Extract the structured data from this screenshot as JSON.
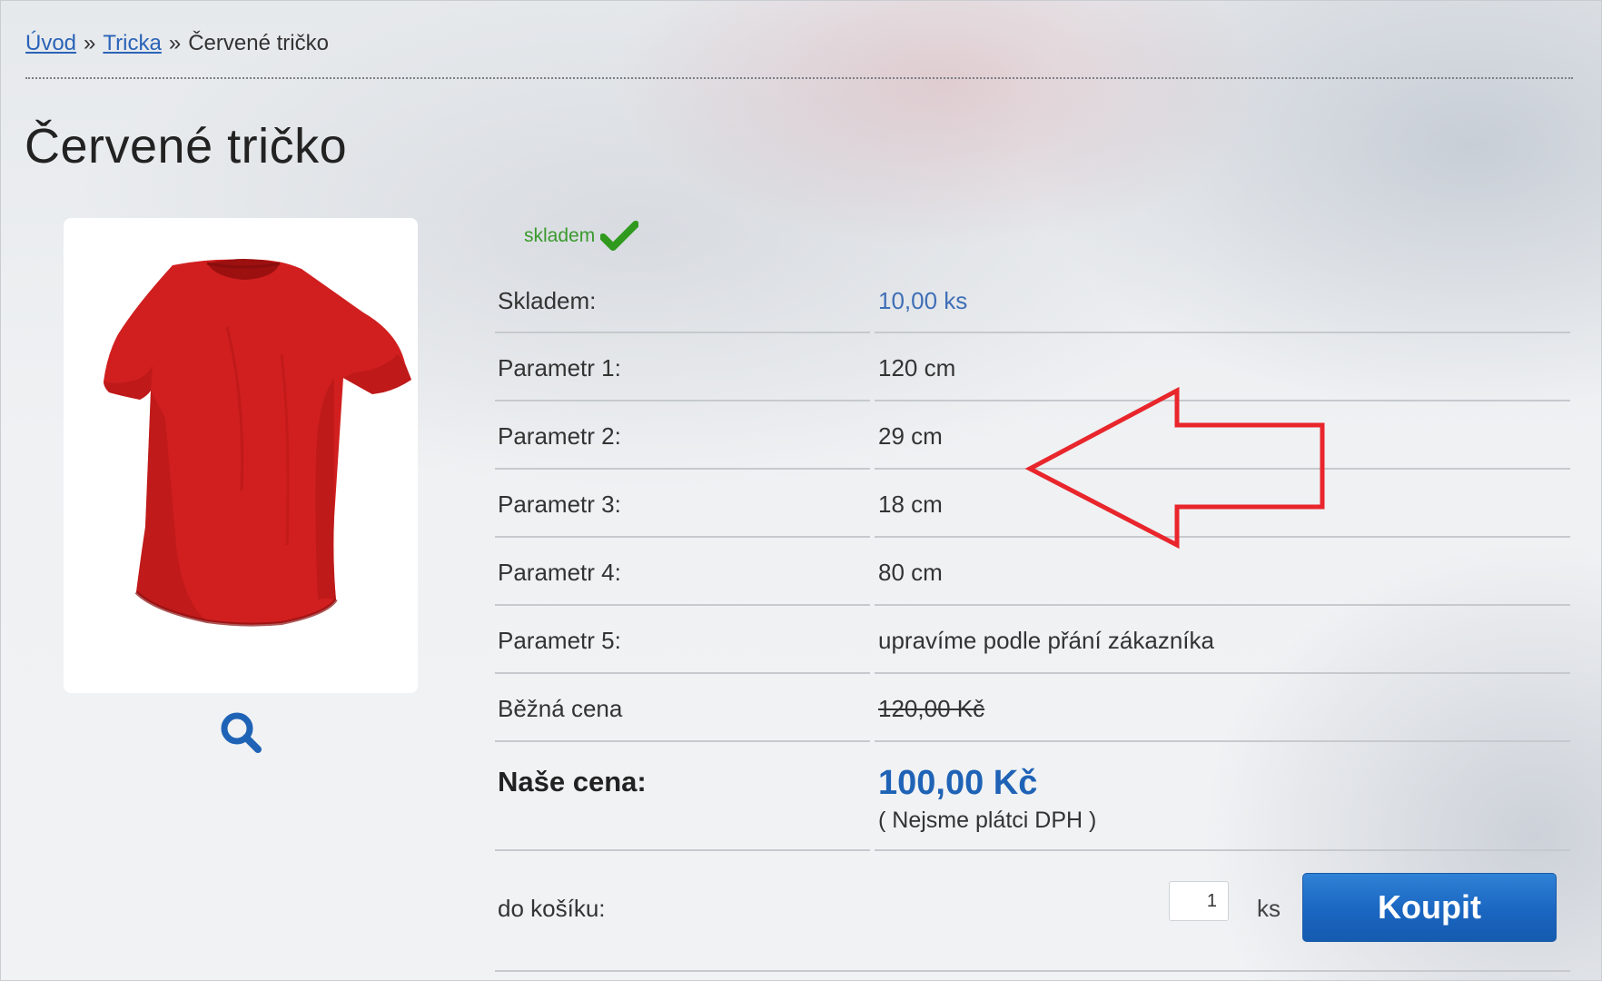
{
  "breadcrumb": {
    "home": "Úvod",
    "category": "Tricka",
    "current": "Červené tričko",
    "separator": "»"
  },
  "product": {
    "title": "Červené tričko",
    "image_icon": "red-tshirt-image",
    "zoom_icon": "magnifier-icon",
    "stock_badge": {
      "text": "skladem",
      "icon": "checkmark-icon",
      "color": "#3a9a2c"
    }
  },
  "params": [
    {
      "label": "Skladem:",
      "value": "10,00 ks"
    },
    {
      "label": "Parametr 1:",
      "value": "120 cm"
    },
    {
      "label": "Parametr 2:",
      "value": "29 cm"
    },
    {
      "label": "Parametr 3:",
      "value": "18 cm"
    },
    {
      "label": "Parametr 4:",
      "value": "80 cm"
    },
    {
      "label": "Parametr 5:",
      "value": "upravíme podle přání zákazníka"
    }
  ],
  "regular_price": {
    "label": "Běžná cena",
    "value": "120,00 Kč"
  },
  "our_price": {
    "label": "Naše cena:",
    "value": "100,00 Kč",
    "note": "( Nejsme plátci DPH )"
  },
  "cart": {
    "label": "do košíku:",
    "quantity": "1",
    "unit": "ks",
    "button": "Koupit"
  },
  "colors": {
    "accent": "#1f63b6",
    "link": "#2a63b8",
    "annotation_arrow": "#e8262c"
  },
  "annotation": {
    "icon": "red-arrow-left"
  }
}
